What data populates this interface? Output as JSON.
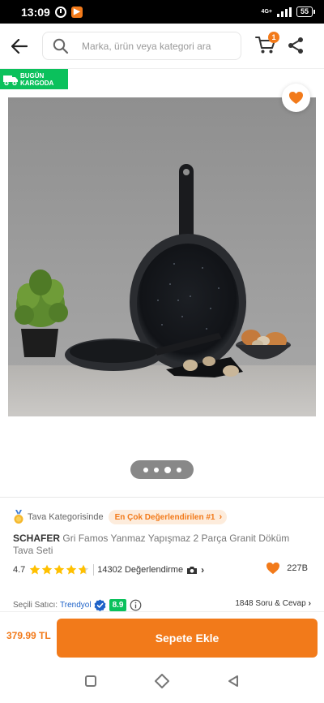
{
  "status_bar": {
    "time": "13:09",
    "network": "4G+",
    "battery": "55"
  },
  "header": {
    "search_placeholder": "Marka, ürün veya kategori ara",
    "cart_count": "1"
  },
  "badge": {
    "line1": "BUGÜN",
    "line2": "KARGODA"
  },
  "carousel": {
    "dots": 4,
    "active_index": 2
  },
  "product": {
    "category_prefix": "Tava Kategorisinde",
    "best_rated_label": "En Çok Değerlendirilen #1",
    "brand": "SCHAFER",
    "title": "Gri Famos Yanmaz Yapışmaz 2 Parça Granit Döküm Tava Seti",
    "rating": "4.7",
    "rating_value": 4.7,
    "review_count": "14302 Değerlendirme",
    "favorite_count": "227B",
    "seller_label": "Seçili Satıcı:",
    "seller_name": "Trendyol",
    "seller_score": "8.9",
    "qa_label": "1848 Soru & Cevap"
  },
  "bottom_bar": {
    "price": "379.99 TL",
    "add_to_cart_label": "Sepete Ekle"
  },
  "colors": {
    "brand_orange": "#f27a1a",
    "badge_green": "#0bc15c",
    "link_blue": "#1e62c8"
  },
  "icons": {
    "back": "arrow-left-icon",
    "search": "search-icon",
    "cart": "cart-icon",
    "share": "share-icon",
    "favorite": "heart-icon",
    "truck": "truck-icon",
    "medal": "medal-icon",
    "star": "star-icon",
    "camera": "camera-icon",
    "verified": "verified-icon",
    "info": "info-icon"
  }
}
